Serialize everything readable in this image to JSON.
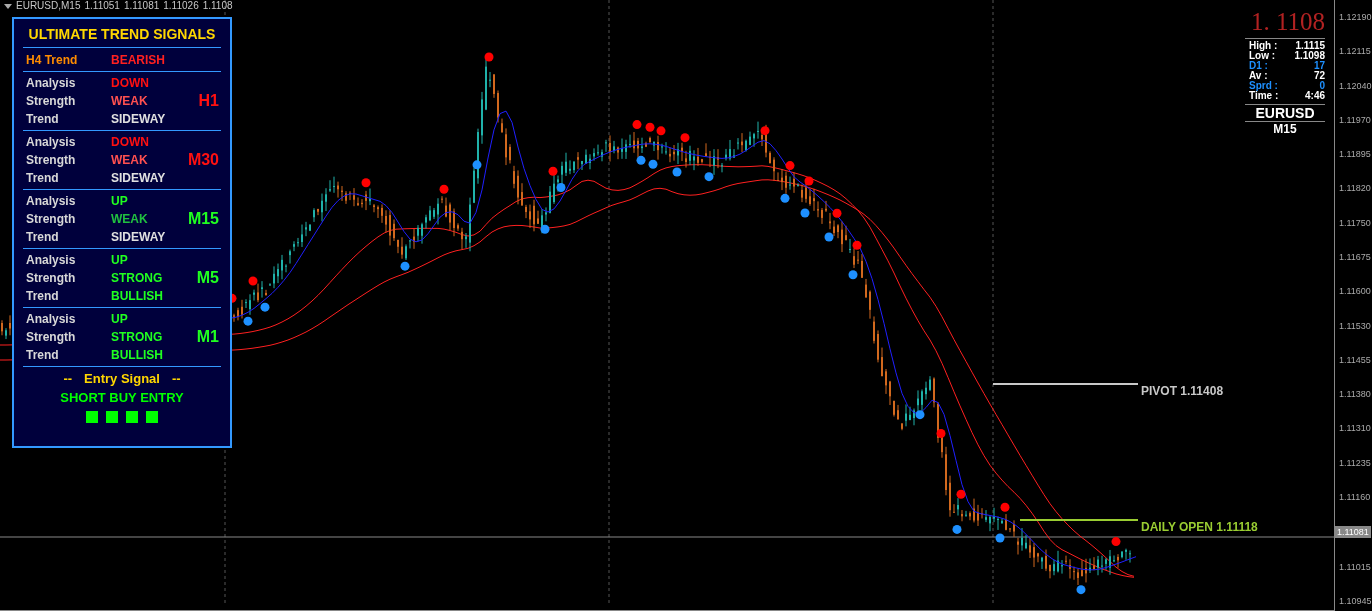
{
  "header": {
    "symbol": "EURUSD,M15",
    "quotes": [
      "1.11051",
      "1.11081",
      "1.11026",
      "1.1108"
    ]
  },
  "panel": {
    "title": "ULTIMATE TREND SIGNALS",
    "h4": {
      "label": "H4 Trend",
      "value": "BEARISH",
      "color": "#ff2020"
    },
    "timeframes": [
      {
        "name": "H1",
        "color": "#ff1010",
        "rows": [
          {
            "label": "Analysis",
            "value": "DOWN",
            "color": "#ff1010"
          },
          {
            "label": "Strength",
            "value": "WEAK",
            "color": "#ff5050"
          },
          {
            "label": "Trend",
            "value": "SIDEWAY",
            "color": "#e0e0e0"
          }
        ]
      },
      {
        "name": "M30",
        "color": "#ff1010",
        "rows": [
          {
            "label": "Analysis",
            "value": "DOWN",
            "color": "#ff1010"
          },
          {
            "label": "Strength",
            "value": "WEAK",
            "color": "#ff5050"
          },
          {
            "label": "Trend",
            "value": "SIDEWAY",
            "color": "#e0e0e0"
          }
        ]
      },
      {
        "name": "M15",
        "color": "#20ff20",
        "rows": [
          {
            "label": "Analysis",
            "value": "UP",
            "color": "#20ff20"
          },
          {
            "label": "Strength",
            "value": "WEAK",
            "color": "#20c040"
          },
          {
            "label": "Trend",
            "value": "SIDEWAY",
            "color": "#e0e0e0"
          }
        ]
      },
      {
        "name": "M5",
        "color": "#20ff20",
        "rows": [
          {
            "label": "Analysis",
            "value": "UP",
            "color": "#20ff20"
          },
          {
            "label": "Strength",
            "value": "STRONG",
            "color": "#20ff20"
          },
          {
            "label": "Trend",
            "value": "BULLISH",
            "color": "#20ff20"
          }
        ]
      },
      {
        "name": "M1",
        "color": "#20ff20",
        "rows": [
          {
            "label": "Analysis",
            "value": "UP",
            "color": "#20ff20"
          },
          {
            "label": "Strength",
            "value": "STRONG",
            "color": "#20ff20"
          },
          {
            "label": "Trend",
            "value": "BULLISH",
            "color": "#20ff20"
          }
        ]
      }
    ],
    "entry": {
      "left_dashes": "--",
      "heading": "Entry Signal",
      "right_dashes": "--",
      "signal": "SHORT BUY ENTRY",
      "squares": [
        {
          "color": "#00ff00"
        },
        {
          "color": "#00ff00"
        },
        {
          "color": "#00ff00"
        },
        {
          "color": "#00ff00"
        }
      ]
    }
  },
  "info": {
    "price": "1. 1108",
    "stats": [
      {
        "label": "High :",
        "value": "1.1115",
        "color": "#ffffff"
      },
      {
        "label": "Low :",
        "value": "1.1098",
        "color": "#ffffff"
      },
      {
        "label": "D1 :",
        "value": "17",
        "color": "#1e90ff"
      },
      {
        "label": "Av :",
        "value": "72",
        "color": "#ffffff"
      },
      {
        "label": "Sprd :",
        "value": "0",
        "color": "#1e90ff"
      },
      {
        "label": "Time :",
        "value": "4:46",
        "color": "#ffffff"
      }
    ],
    "symbol": "EURUSD",
    "timeframe": "M15"
  },
  "levels": [
    {
      "label": "PIVOT 1.11408",
      "color": "#c8c8c8"
    },
    {
      "label": "DAILY OPEN 1.11118",
      "color": "#9acd32"
    }
  ],
  "axis": {
    "ticks": [
      {
        "kind": "tick",
        "label": "1.12190"
      },
      {
        "kind": "tick",
        "label": "1.12115"
      },
      {
        "kind": "tick",
        "label": "1.12040"
      },
      {
        "kind": "tick",
        "label": "1.11970"
      },
      {
        "kind": "tick",
        "label": "1.11895"
      },
      {
        "kind": "tick",
        "label": "1.11820"
      },
      {
        "kind": "tick",
        "label": "1.11750"
      },
      {
        "kind": "tick",
        "label": "1.11675"
      },
      {
        "kind": "tick",
        "label": "1.11600"
      },
      {
        "kind": "tick",
        "label": "1.11530"
      },
      {
        "kind": "tick",
        "label": "1.11455"
      },
      {
        "kind": "tick",
        "label": "1.11380"
      },
      {
        "kind": "tick",
        "label": "1.11310"
      },
      {
        "kind": "tick",
        "label": "1.11235"
      },
      {
        "kind": "tick",
        "label": "1.11160"
      },
      {
        "kind": "current",
        "label": "1.11081"
      },
      {
        "kind": "tick",
        "label": "1.11015"
      },
      {
        "kind": "tick",
        "label": "1.10945"
      }
    ]
  }
}
